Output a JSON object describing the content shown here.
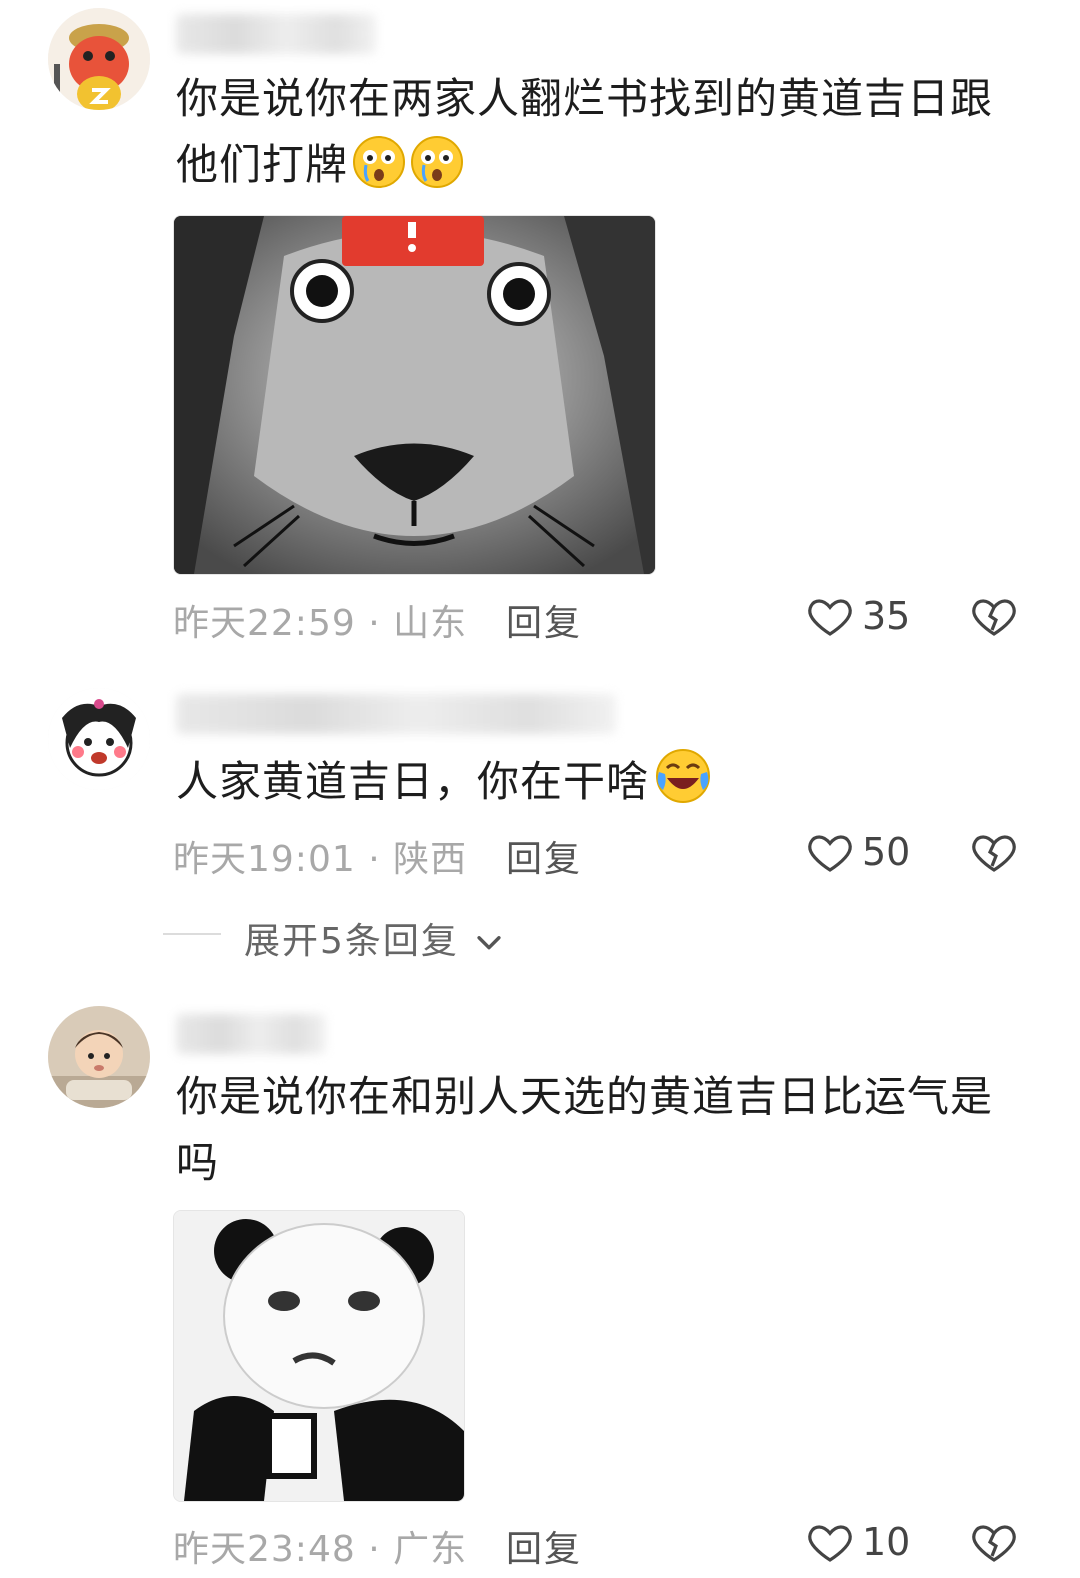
{
  "comments": [
    {
      "text_line1": "你是说你在两家人翻烂书找到的黄道吉日跟",
      "text_line2": "他们打牌",
      "emoji": "crying-face-emoji",
      "meta": "昨天22:59 · 山东",
      "reply_label": "回复",
      "likes": "35"
    },
    {
      "text": "人家黄道吉日，你在干啥",
      "emoji": "laughing-tears-emoji",
      "meta": "昨天19:01 · 陕西",
      "reply_label": "回复",
      "likes": "50",
      "expand_label": "展开5条回复"
    },
    {
      "text_line1": "你是说你在和别人天选的黄道吉日比运气是",
      "text_line2": "吗",
      "meta": "昨天23:48 · 广东",
      "reply_label": "回复",
      "likes": "10"
    }
  ],
  "icons": {
    "like": "heart-outline-icon",
    "dislike": "broken-heart-icon",
    "expand": "chevron-down-icon"
  },
  "colors": {
    "meta_text": "#a8a8a8",
    "body_text": "#1d1d1d",
    "avatar1_bg": "#e8533a"
  }
}
